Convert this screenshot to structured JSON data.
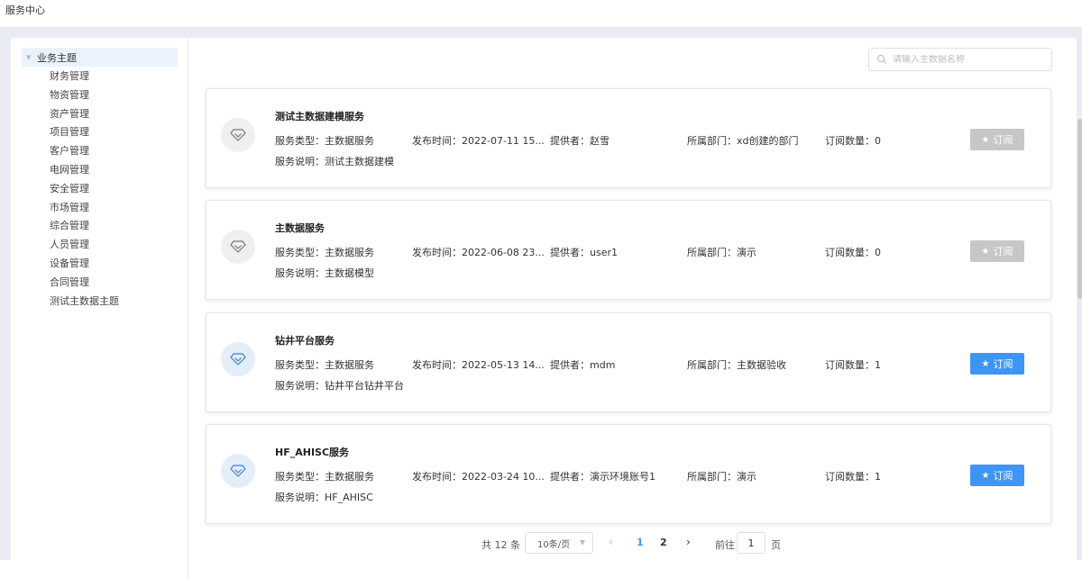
{
  "app": {
    "title": "服务中心"
  },
  "sidebar": {
    "root": {
      "label": "业务主题"
    },
    "items": [
      {
        "label": "财务管理"
      },
      {
        "label": "物资管理"
      },
      {
        "label": "资产管理"
      },
      {
        "label": "项目管理"
      },
      {
        "label": "客户管理"
      },
      {
        "label": "电网管理"
      },
      {
        "label": "安全管理"
      },
      {
        "label": "市场管理"
      },
      {
        "label": "综合管理"
      },
      {
        "label": "人员管理"
      },
      {
        "label": "设备管理"
      },
      {
        "label": "合同管理"
      },
      {
        "label": "测试主数据主题"
      }
    ]
  },
  "search": {
    "placeholder": "请输入主数据名称",
    "value": ""
  },
  "services": [
    {
      "name": "测试主数据建模服务",
      "type": "服务类型：主数据服务",
      "time": "发布时间：2022-07-11 15...",
      "provider": "提供者：赵雪",
      "dept": "所属部门：xd创建的部门",
      "subs": "订阅数量：0",
      "desc": "服务说明：测试主数据建模",
      "subscribe_label": "订阅",
      "subscribe_enabled": false
    },
    {
      "name": "主数据服务",
      "type": "服务类型：主数据服务",
      "time": "发布时间：2022-06-08 23...",
      "provider": "提供者：user1",
      "dept": "所属部门：演示",
      "subs": "订阅数量：0",
      "desc": "服务说明：主数据模型",
      "subscribe_label": "订阅",
      "subscribe_enabled": false
    },
    {
      "name": "钻井平台服务",
      "type": "服务类型：主数据服务",
      "time": "发布时间：2022-05-13 14...",
      "provider": "提供者：mdm",
      "dept": "所属部门：主数据验收",
      "subs": "订阅数量：1",
      "desc": "服务说明：钻井平台钻井平台",
      "subscribe_label": "订阅",
      "subscribe_enabled": true
    },
    {
      "name": "HF_AHISC服务",
      "type": "服务类型：主数据服务",
      "time": "发布时间：2022-03-24 10...",
      "provider": "提供者：演示环境账号1",
      "dept": "所属部门：演示",
      "subs": "订阅数量：1",
      "desc": "服务说明：HF_AHISC",
      "subscribe_label": "订阅",
      "subscribe_enabled": true
    }
  ],
  "pagination": {
    "total": "共 12 条",
    "page_size": "10条/页",
    "pages": [
      "1",
      "2"
    ],
    "current": "1",
    "goto_label": "前往",
    "goto_value": "1",
    "goto_suffix": "页"
  },
  "colors": {
    "accent": "#3e95f5",
    "disabled": "#c7c7c7",
    "tree_selected": "#eaf3fd",
    "background": "#e9ecf2"
  }
}
